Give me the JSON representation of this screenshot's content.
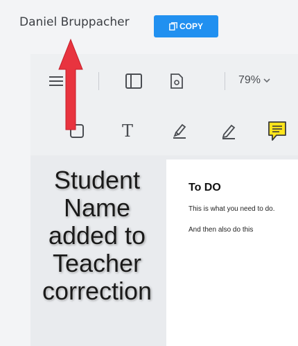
{
  "header": {
    "student_name": "Daniel Bruppacher",
    "copy_label": "COPY"
  },
  "toolbar": {
    "zoom_value": "79%",
    "icons": [
      "menu-icon",
      "sidebar-icon",
      "page-settings-icon",
      "chevron-down-icon",
      "rectangle-icon",
      "text-icon",
      "highlighter-icon",
      "pen-icon",
      "comment-icon"
    ]
  },
  "document": {
    "title": "To DO",
    "line1": "This is what you need to do.",
    "line2": "And then also do this"
  },
  "annotation": {
    "lines": [
      "Student",
      "Name",
      "added to",
      "Teacher",
      "correction"
    ]
  },
  "colors": {
    "copy_button": "#2190f0",
    "arrow": "#e8343f",
    "comment_fill": "#ffe41c"
  }
}
